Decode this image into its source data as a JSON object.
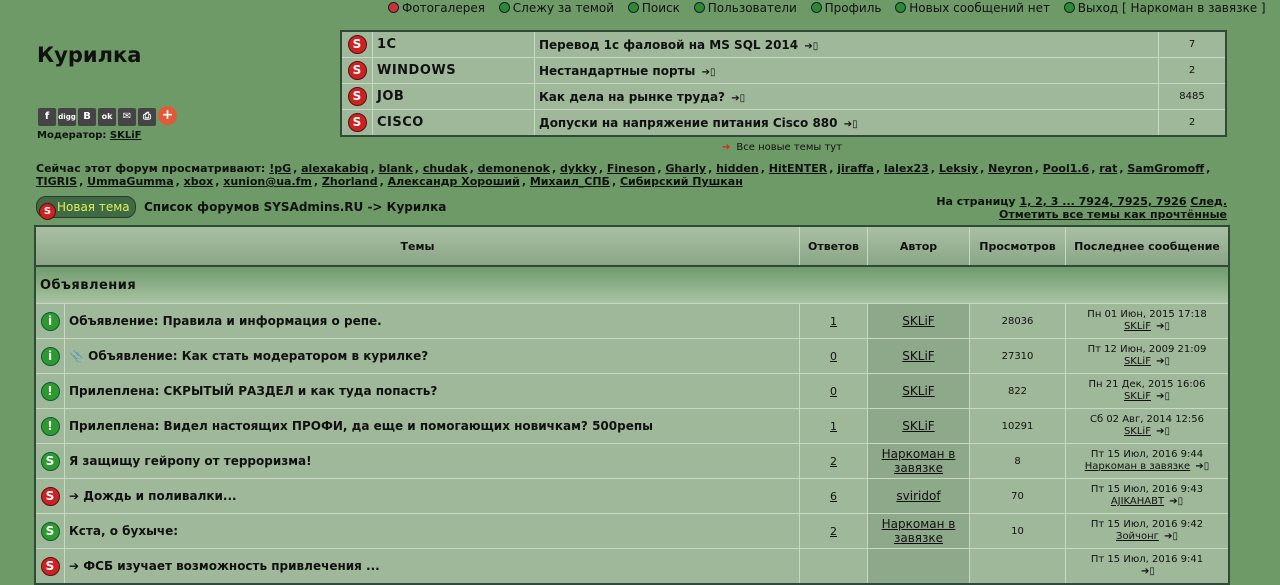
{
  "nav": [
    {
      "label": "Фотогалерея",
      "icon": "red-ball-icon"
    },
    {
      "label": "Слежу за темой",
      "icon": "green-ball-icon"
    },
    {
      "label": "Поиск",
      "icon": "green-ball-icon"
    },
    {
      "label": "Пользователи",
      "icon": "green-ball-icon"
    },
    {
      "label": "Профиль",
      "icon": "green-ball-icon"
    },
    {
      "label": "Новых сообщений нет",
      "icon": "green-ball-icon"
    },
    {
      "label": "Выход [ Наркоман в завязке ]",
      "icon": "green-ball-icon"
    }
  ],
  "forum_title": "Курилка",
  "share_buttons": [
    "f",
    "digg",
    "B",
    "ok",
    "mail",
    "print",
    "+"
  ],
  "moderator": {
    "label": "Модератор:",
    "name": "SKLiF"
  },
  "recent_topics": [
    {
      "category": "1C",
      "title": "Перевод 1с фаловой на MS SQL 2014",
      "count": "7"
    },
    {
      "category": "WINDOWS",
      "title": "Нестандартные порты",
      "count": "2"
    },
    {
      "category": "JOB",
      "title": "Как дела на рынке труда?",
      "count": "8485"
    },
    {
      "category": "CISCO",
      "title": "Допуски на напряжение питания Cisco 880",
      "count": "2"
    }
  ],
  "all_new": "Все новые темы тут",
  "viewers": {
    "label": "Сейчас этот форум просматривают:",
    "users": [
      "!pG",
      "alexakabiq",
      "blank",
      "chudak",
      "demonenok",
      "dykky",
      "Fineson",
      "Gharly",
      "hidden",
      "HitENTER",
      "jiraffa",
      "lalex23",
      "Leksiy",
      "Neyron",
      "Pool1.6",
      "rat",
      "SamGromoff",
      "TIGRIS",
      "UmmaGumma",
      "xbox",
      "xunion@ua.fm",
      "Zhorland",
      "Александр Хороший",
      "Михаил_СПБ",
      "Сибирский Пушкан"
    ]
  },
  "new_topic": "Новая тема",
  "breadcrumb": "Список форумов SYSAdmins.RU -> Курилка",
  "pager": {
    "prefix": "На страницу",
    "current": "1",
    "text": "1, 2, 3 ... 7924, 7925, 7926",
    "next": "След.",
    "mark_read": "Отметить все темы как прочтённые"
  },
  "table": {
    "headers": {
      "topics": "Темы",
      "replies": "Ответов",
      "author": "Автор",
      "views": "Просмотров",
      "last": "Последнее сообщение"
    },
    "section": "Объявления",
    "rows": [
      {
        "icon": "info",
        "prefix": "",
        "title": "Объявление: Правила и информация о репе.",
        "replies": "1",
        "author": "SKLiF",
        "views": "28036",
        "last_date": "Пн 01 Июн, 2015 17:18",
        "last_user": "SKLiF"
      },
      {
        "icon": "info",
        "prefix": "📎",
        "title": "Объявление: Как стать модератором в курилке?",
        "replies": "0",
        "author": "SKLiF",
        "views": "27310",
        "last_date": "Пт 12 Июн, 2009 21:09",
        "last_user": "SKLiF"
      },
      {
        "icon": "sticky",
        "prefix": "",
        "title": "Прилеплена: СКРЫТЫЙ РАЗДЕЛ и как туда попасть?",
        "replies": "0",
        "author": "SKLiF",
        "views": "822",
        "last_date": "Пн 21 Дек, 2015 16:06",
        "last_user": "SKLiF"
      },
      {
        "icon": "sticky",
        "prefix": "",
        "title": "Прилеплена: Видел настоящих ПРОФИ, да еще и помогающих новичкам? 500репы",
        "replies": "1",
        "author": "SKLiF",
        "views": "10291",
        "last_date": "Сб 02 Авг, 2014 12:56",
        "last_user": "SKLiF"
      },
      {
        "icon": "green",
        "prefix": "",
        "title": "Я защищу гейропу от терроризма!",
        "replies": "2",
        "author": "Наркоман в завязке",
        "views": "8",
        "last_date": "Пт 15 Июл, 2016 9:44",
        "last_user": "Наркоман в завязке"
      },
      {
        "icon": "red",
        "prefix": "➔",
        "title": "Дождь и поливалки...",
        "replies": "6",
        "author": "sviridof",
        "views": "70",
        "last_date": "Пт 15 Июл, 2016 9:43",
        "last_user": "AJIKAHABT"
      },
      {
        "icon": "green",
        "prefix": "",
        "title": "Кста, о бухыче:",
        "replies": "2",
        "author": "Наркоман в завязке",
        "views": "10",
        "last_date": "Пт 15 Июл, 2016 9:42",
        "last_user": "Зойчонг"
      },
      {
        "icon": "red",
        "prefix": "➔",
        "title": "ФСБ изучает возможность привлечения ...",
        "replies": "",
        "author": "",
        "views": "",
        "last_date": "Пт 15 Июл, 2016 9:41",
        "last_user": ""
      }
    ]
  },
  "colors": {
    "background": "#6e9a67",
    "table": "#9fb89a",
    "accent_red": "#cc2222",
    "accent_green": "#2d9a2d"
  }
}
